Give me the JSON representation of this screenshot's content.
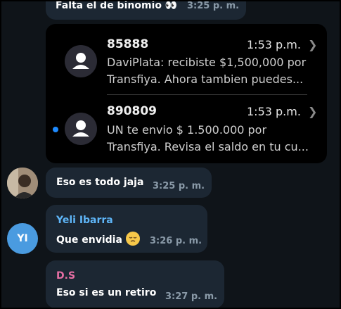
{
  "messages": [
    {
      "text": "Falta el de binomio 👀",
      "time": "3:25 p. m."
    },
    {
      "text": "Eso es todo jaja",
      "time": "3:25 p. m."
    },
    {
      "sender": "Yeli Ibarra",
      "sender_color": "#5eb5f7",
      "text": "Que envidia",
      "time": "3:26 p. m.",
      "avatar_initials": "YI"
    },
    {
      "sender": "D.S",
      "sender_color": "#e76fa4",
      "text": "Eso si es un retiro",
      "time": "3:27 p. m."
    }
  ],
  "notifications": [
    {
      "title": "85888",
      "time": "1:53 p.m.",
      "line1": "DaviPlata: recibiste $1,500,000 por",
      "line2": "Transfiya. Ahora tambien puedes..."
    },
    {
      "title": "890809",
      "time": "1:53 p.m.",
      "line1": "UN te envio $ 1.500.000 por",
      "line2": "Transfiya. Revisa el saldo en tu cu..."
    }
  ],
  "colors": {
    "bubble": "#1c2733",
    "background": "#0f1419",
    "unread": "#1e8bff"
  }
}
